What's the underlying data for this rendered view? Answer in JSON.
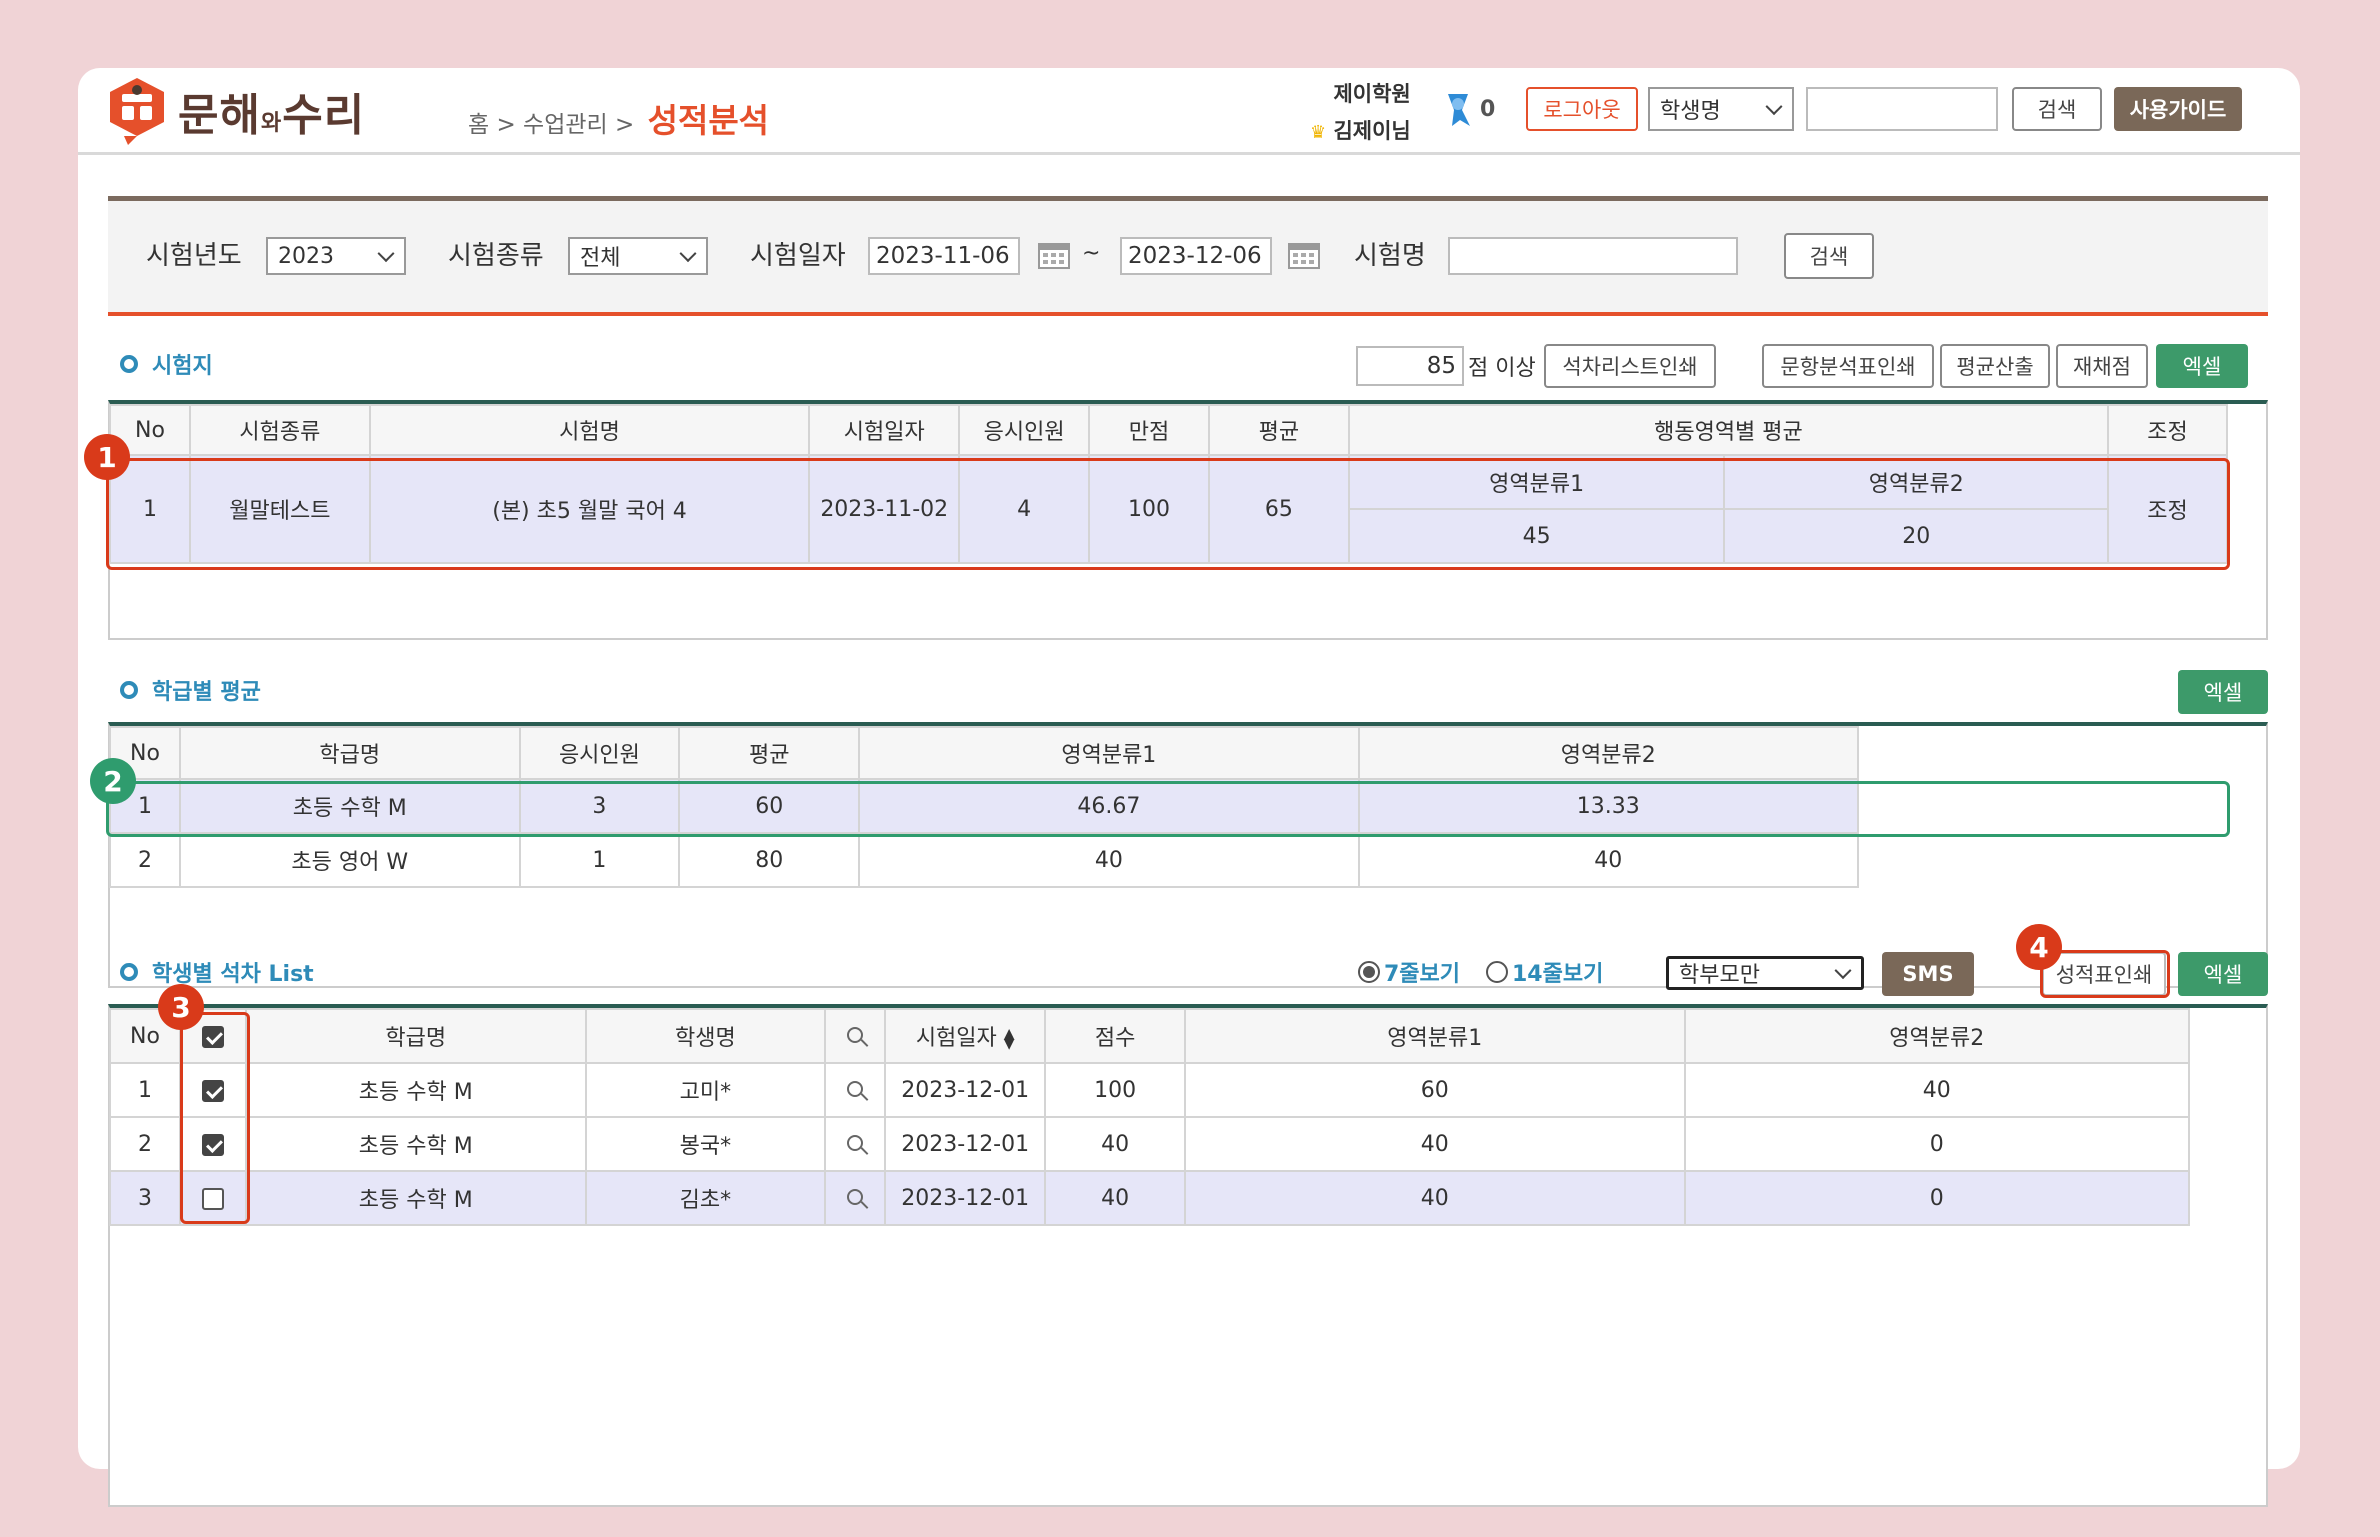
{
  "header": {
    "brand_main": "문해",
    "brand_small": "와",
    "brand_tail": "수리",
    "breadcrumb": "홈 > 수업관리 >",
    "page_title": "성적분석",
    "academy": "제이학원",
    "user": "김제이님",
    "point_count": "0",
    "logout_label": "로그아웃",
    "search_type": "학생명",
    "search_label": "검색",
    "guide_label": "사용가이드"
  },
  "filter": {
    "year_label": "시험년도",
    "year_value": "2023",
    "type_label": "시험종류",
    "type_value": "전체",
    "date_label": "시험일자",
    "date_from": "2023-11-06",
    "date_sep": "~",
    "date_to": "2023-12-06",
    "name_label": "시험명",
    "search_label": "검색"
  },
  "exams": {
    "title": "시험지",
    "threshold": "85",
    "threshold_suffix": "점 이상",
    "btn_rank_print": "석차리스트인쇄",
    "btn_item_print": "문항분석표인쇄",
    "btn_avg": "평균산출",
    "btn_regrade": "재채점",
    "btn_excel": "엑셀",
    "headers": {
      "no": "No",
      "type": "시험종류",
      "name": "시험명",
      "date": "시험일자",
      "count": "응시인원",
      "full": "만점",
      "avg": "평균",
      "area_avg": "행동영역별 평균",
      "adjust": "조정"
    },
    "row": {
      "no": "1",
      "type": "월말테스트",
      "name": "(본) 초5 월말 국어 4",
      "date": "2023-11-02",
      "count": "4",
      "full": "100",
      "avg": "65",
      "area1": "영역분류1",
      "area2": "영역분류2",
      "area1_val": "45",
      "area2_val": "20",
      "adjust": "조정"
    }
  },
  "classes": {
    "title": "학급별 평균",
    "btn_excel": "엑셀",
    "headers": {
      "no": "No",
      "name": "학급명",
      "count": "응시인원",
      "avg": "평균",
      "area1": "영역분류1",
      "area2": "영역분류2"
    },
    "rows": [
      {
        "no": "1",
        "name": "초등 수학 M",
        "count": "3",
        "avg": "60",
        "area1": "46.67",
        "area2": "13.33"
      },
      {
        "no": "2",
        "name": "초등 영어 W",
        "count": "1",
        "avg": "80",
        "area1": "40",
        "area2": "40"
      }
    ]
  },
  "students": {
    "title": "학생별 석차 List",
    "view7": "7줄보기",
    "view14": "14줄보기",
    "target": "학부모만",
    "btn_sms": "SMS",
    "btn_print": "성적표인쇄",
    "btn_excel": "엑셀",
    "headers": {
      "no": "No",
      "class": "학급명",
      "name": "학생명",
      "date": "시험일자",
      "score": "점수",
      "area1": "영역분류1",
      "area2": "영역분류2"
    },
    "rows": [
      {
        "no": "1",
        "class": "초등 수학 M",
        "name": "고미*",
        "date": "2023-12-01",
        "score": "100",
        "area1": "60",
        "area2": "40"
      },
      {
        "no": "2",
        "class": "초등 수학 M",
        "name": "봉국*",
        "date": "2023-12-01",
        "score": "40",
        "area1": "40",
        "area2": "0"
      },
      {
        "no": "3",
        "class": "초등 수학 M",
        "name": "김초*",
        "date": "2023-12-01",
        "score": "40",
        "area1": "40",
        "area2": "0"
      }
    ]
  },
  "annotations": [
    "1",
    "2",
    "3",
    "4"
  ]
}
